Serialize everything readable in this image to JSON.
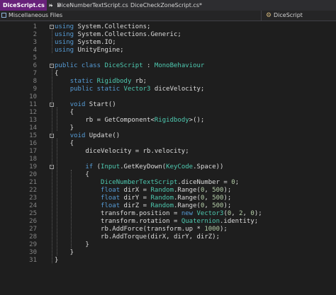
{
  "tabs": [
    {
      "label": "DiceScript.cs",
      "active": true,
      "pinned": true
    },
    {
      "label": "DiceNumberTextScript.cs",
      "active": false,
      "pinned": false
    },
    {
      "label": "DiceCheckZoneScript.cs*",
      "active": false,
      "pinned": false
    }
  ],
  "navigation": {
    "project": "Miscellaneous Files",
    "member": "DiceScript"
  },
  "colors": {
    "active_tab": "#68217a",
    "editor_background": "#1e1e1e",
    "keyword": "#569cd6",
    "type": "#4ec9b0",
    "number": "#b5cea8",
    "line_number": "#858585"
  },
  "code": {
    "lines": [
      {
        "n": "1",
        "fold": "minus",
        "tokens": [
          [
            "kw",
            "using"
          ],
          [
            "plain",
            " System.Collections;"
          ]
        ]
      },
      {
        "n": "2",
        "tokens": [
          [
            "kw",
            "using"
          ],
          [
            "plain",
            " System.Collections.Generic;"
          ]
        ]
      },
      {
        "n": "3",
        "tokens": [
          [
            "kw",
            "using"
          ],
          [
            "plain",
            " System.IO;"
          ]
        ]
      },
      {
        "n": "4",
        "tokens": [
          [
            "kw",
            "using"
          ],
          [
            "plain",
            " UnityEngine;"
          ]
        ]
      },
      {
        "n": "5",
        "tokens": []
      },
      {
        "n": "6",
        "fold": "minus",
        "tokens": [
          [
            "kw",
            "public class "
          ],
          [
            "type",
            "DiceScript"
          ],
          [
            "plain",
            " : "
          ],
          [
            "type",
            "MonoBehaviour"
          ]
        ]
      },
      {
        "n": "7",
        "tokens": [
          [
            "plain",
            "{"
          ]
        ]
      },
      {
        "n": "8",
        "tokens": [
          [
            "plain",
            "    "
          ],
          [
            "kw",
            "static "
          ],
          [
            "type",
            "Rigidbody"
          ],
          [
            "plain",
            " rb;"
          ]
        ]
      },
      {
        "n": "9",
        "tokens": [
          [
            "plain",
            "    "
          ],
          [
            "kw",
            "public static "
          ],
          [
            "type",
            "Vector3"
          ],
          [
            "plain",
            " diceVelocity;"
          ]
        ]
      },
      {
        "n": "10",
        "tokens": []
      },
      {
        "n": "11",
        "fold": "minus",
        "tokens": [
          [
            "plain",
            "    "
          ],
          [
            "kw",
            "void "
          ],
          [
            "plain",
            "Start()"
          ]
        ]
      },
      {
        "n": "12",
        "tokens": [
          [
            "plain",
            "    {"
          ]
        ]
      },
      {
        "n": "13",
        "tokens": [
          [
            "plain",
            "        rb = GetComponent<"
          ],
          [
            "type",
            "Rigidbody"
          ],
          [
            "plain",
            ">();"
          ]
        ]
      },
      {
        "n": "14",
        "tokens": [
          [
            "plain",
            "    }"
          ]
        ]
      },
      {
        "n": "15",
        "fold": "minus",
        "tokens": [
          [
            "plain",
            "    "
          ],
          [
            "kw",
            "void "
          ],
          [
            "plain",
            "Update()"
          ]
        ]
      },
      {
        "n": "16",
        "tokens": [
          [
            "plain",
            "    {"
          ]
        ]
      },
      {
        "n": "17",
        "tokens": [
          [
            "plain",
            "        diceVelocity = rb.velocity;"
          ]
        ]
      },
      {
        "n": "18",
        "tokens": []
      },
      {
        "n": "19",
        "fold": "minus",
        "tokens": [
          [
            "plain",
            "        "
          ],
          [
            "kw",
            "if "
          ],
          [
            "plain",
            "("
          ],
          [
            "type",
            "Input"
          ],
          [
            "plain",
            ".GetKeyDown("
          ],
          [
            "type",
            "KeyCode"
          ],
          [
            "plain",
            ".Space))"
          ]
        ]
      },
      {
        "n": "20",
        "tokens": [
          [
            "plain",
            "        {"
          ]
        ]
      },
      {
        "n": "21",
        "tokens": [
          [
            "plain",
            "            "
          ],
          [
            "type",
            "DiceNumberTextScript"
          ],
          [
            "plain",
            ".diceNumber = "
          ],
          [
            "num",
            "0"
          ],
          [
            "plain",
            ";"
          ]
        ]
      },
      {
        "n": "22",
        "tokens": [
          [
            "plain",
            "            "
          ],
          [
            "kw",
            "float "
          ],
          [
            "plain",
            "dirX = "
          ],
          [
            "type",
            "Random"
          ],
          [
            "plain",
            ".Range("
          ],
          [
            "num",
            "0"
          ],
          [
            "plain",
            ", "
          ],
          [
            "num",
            "500"
          ],
          [
            "plain",
            ");"
          ]
        ]
      },
      {
        "n": "23",
        "tokens": [
          [
            "plain",
            "            "
          ],
          [
            "kw",
            "float "
          ],
          [
            "plain",
            "dirY = "
          ],
          [
            "type",
            "Random"
          ],
          [
            "plain",
            ".Range("
          ],
          [
            "num",
            "0"
          ],
          [
            "plain",
            ", "
          ],
          [
            "num",
            "500"
          ],
          [
            "plain",
            ");"
          ]
        ]
      },
      {
        "n": "24",
        "tokens": [
          [
            "plain",
            "            "
          ],
          [
            "kw",
            "float "
          ],
          [
            "plain",
            "dirZ = "
          ],
          [
            "type",
            "Random"
          ],
          [
            "plain",
            ".Range("
          ],
          [
            "num",
            "0"
          ],
          [
            "plain",
            ", "
          ],
          [
            "num",
            "500"
          ],
          [
            "plain",
            ");"
          ]
        ]
      },
      {
        "n": "25",
        "tokens": [
          [
            "plain",
            "            transform.position = "
          ],
          [
            "kw",
            "new "
          ],
          [
            "type",
            "Vector3"
          ],
          [
            "plain",
            "("
          ],
          [
            "num",
            "0"
          ],
          [
            "plain",
            ", "
          ],
          [
            "num",
            "2"
          ],
          [
            "plain",
            ", "
          ],
          [
            "num",
            "0"
          ],
          [
            "plain",
            ");"
          ]
        ]
      },
      {
        "n": "26",
        "tokens": [
          [
            "plain",
            "            transform.rotation = "
          ],
          [
            "type",
            "Quaternion"
          ],
          [
            "plain",
            ".identity;"
          ]
        ]
      },
      {
        "n": "27",
        "tokens": [
          [
            "plain",
            "            rb.AddForce(transform.up * "
          ],
          [
            "num",
            "1000"
          ],
          [
            "plain",
            ");"
          ]
        ]
      },
      {
        "n": "28",
        "tokens": [
          [
            "plain",
            "            rb.AddTorque(dirX, dirY, dirZ);"
          ]
        ]
      },
      {
        "n": "29",
        "tokens": [
          [
            "plain",
            "        }"
          ]
        ]
      },
      {
        "n": "30",
        "tokens": [
          [
            "plain",
            "    }"
          ]
        ]
      },
      {
        "n": "31",
        "tokens": [
          [
            "plain",
            "}"
          ]
        ]
      }
    ]
  }
}
